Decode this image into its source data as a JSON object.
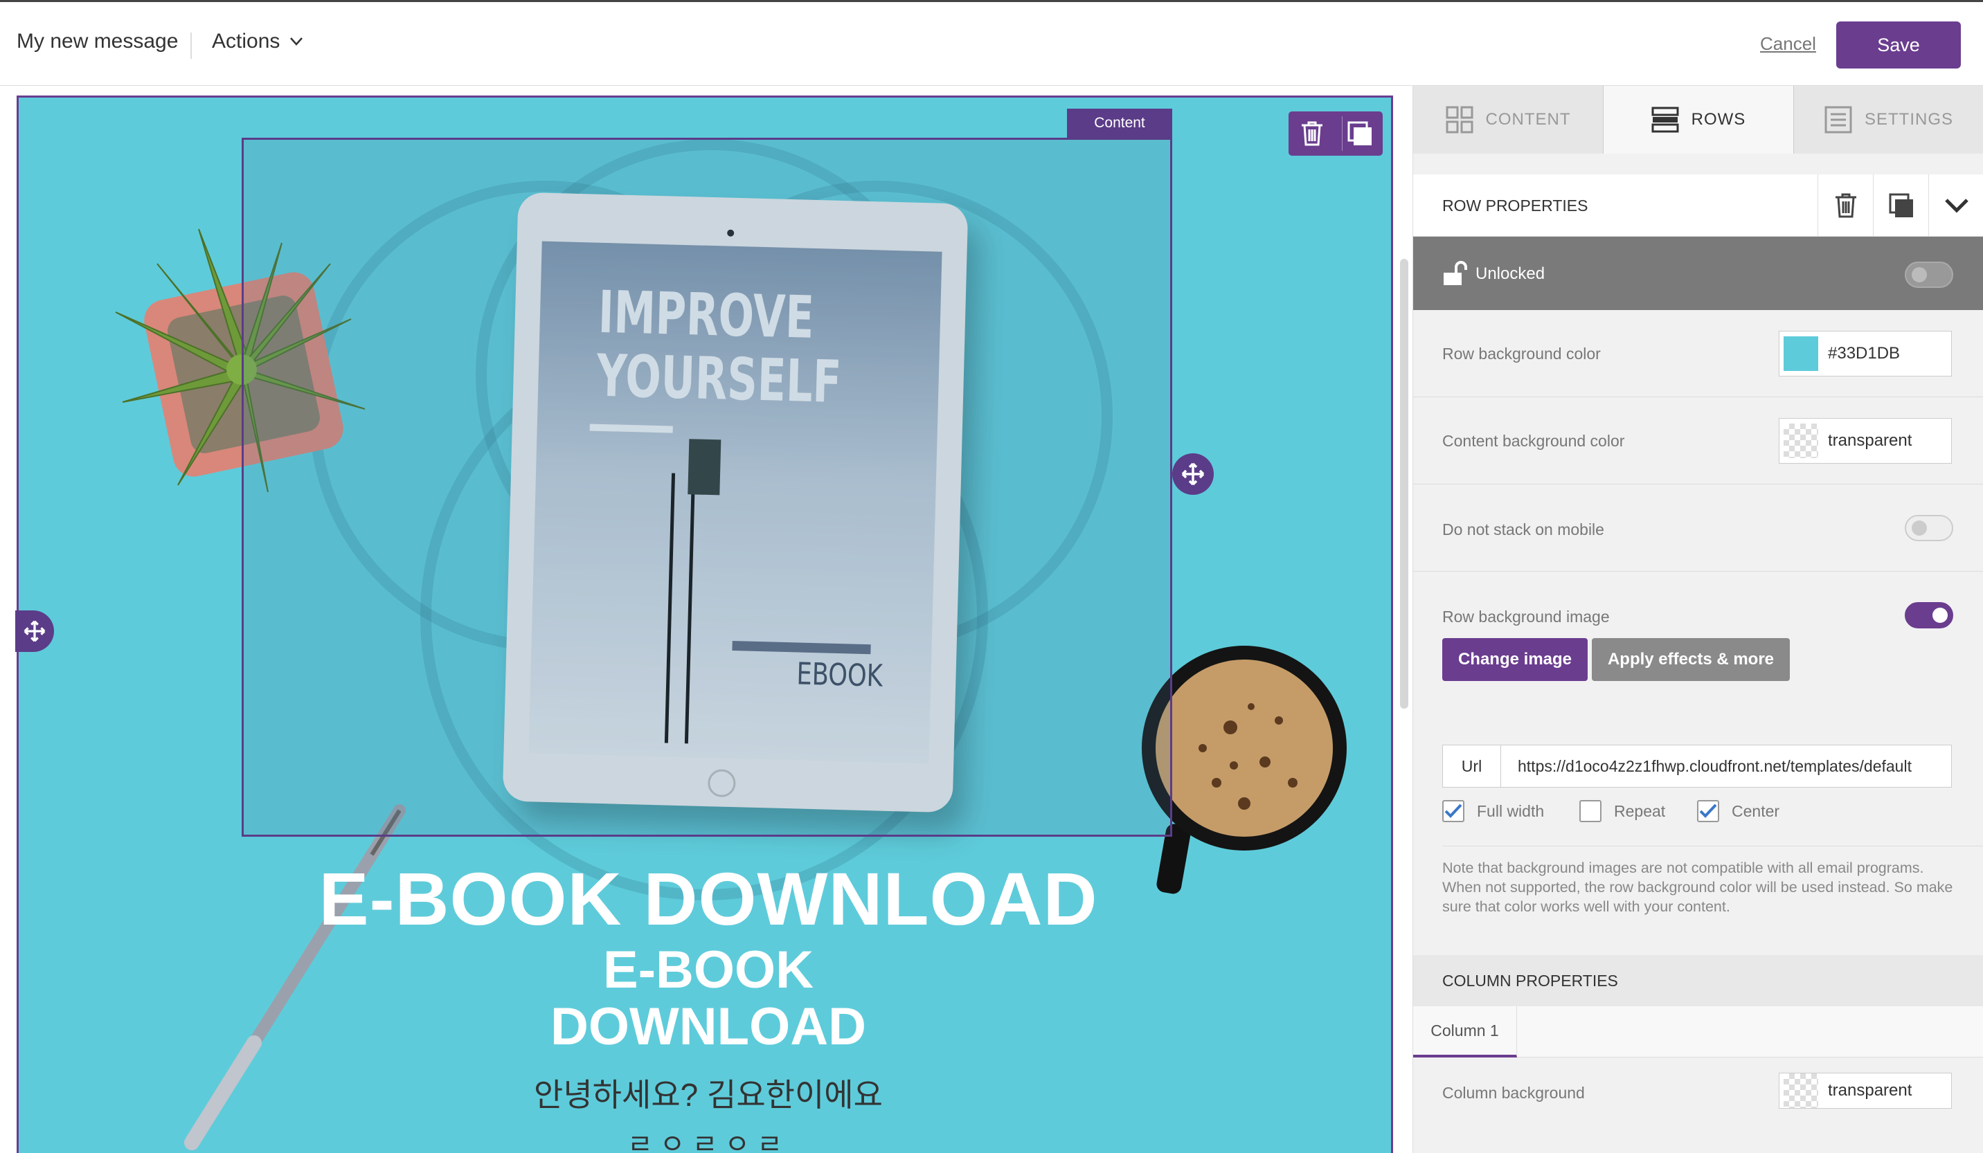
{
  "topbar": {
    "title": "My new message",
    "actions_label": "Actions",
    "cancel_label": "Cancel",
    "save_label": "Save"
  },
  "canvas": {
    "content_tag": "Content",
    "headline": "E-BOOK DOWNLOAD",
    "subheadline_line1": "E-BOOK",
    "subheadline_line2": "DOWNLOAD",
    "korean_text": "안녕하세요? 김요한이에요",
    "korean_text2": "ㄹㅇㄹㅇㄹ",
    "tablet_text1": "IMPROVE",
    "tablet_text2": "YOURSELF",
    "tablet_text3": "EBOOK",
    "row_bg_color": "#5ecbda"
  },
  "panel": {
    "tabs": [
      {
        "label": "CONTENT",
        "icon": "grid-icon",
        "active": false
      },
      {
        "label": "ROWS",
        "icon": "rows-icon",
        "active": true
      },
      {
        "label": "SETTINGS",
        "icon": "settings-list-icon",
        "active": false
      }
    ],
    "row_properties_title": "ROW PROPERTIES",
    "lock_label": "Unlocked",
    "row_bg_label": "Row background color",
    "row_bg_value": "#33D1DB",
    "row_bg_swatch": "#5ecbda",
    "content_bg_label": "Content background color",
    "content_bg_value": "transparent",
    "no_stack_label": "Do not stack on mobile",
    "row_bg_image_label": "Row background image",
    "change_image_label": "Change image",
    "apply_effects_label": "Apply effects & more",
    "url_label": "Url",
    "url_value": "https://d1oco4z2z1fhwp.cloudfront.net/templates/default",
    "full_width_label": "Full width",
    "repeat_label": "Repeat",
    "center_label": "Center",
    "full_width_checked": true,
    "repeat_checked": false,
    "center_checked": true,
    "note": "Note that background images are not compatible with all email programs. When not supported, the row background color will be used instead. So make sure that color works well with your content.",
    "column_properties_title": "COLUMN PROPERTIES",
    "column_tab": "Column 1",
    "column_bg_label": "Column background",
    "column_bg_value": "transparent"
  },
  "colors": {
    "accent": "#6a3d8f",
    "row_bg": "#5ecbda"
  }
}
